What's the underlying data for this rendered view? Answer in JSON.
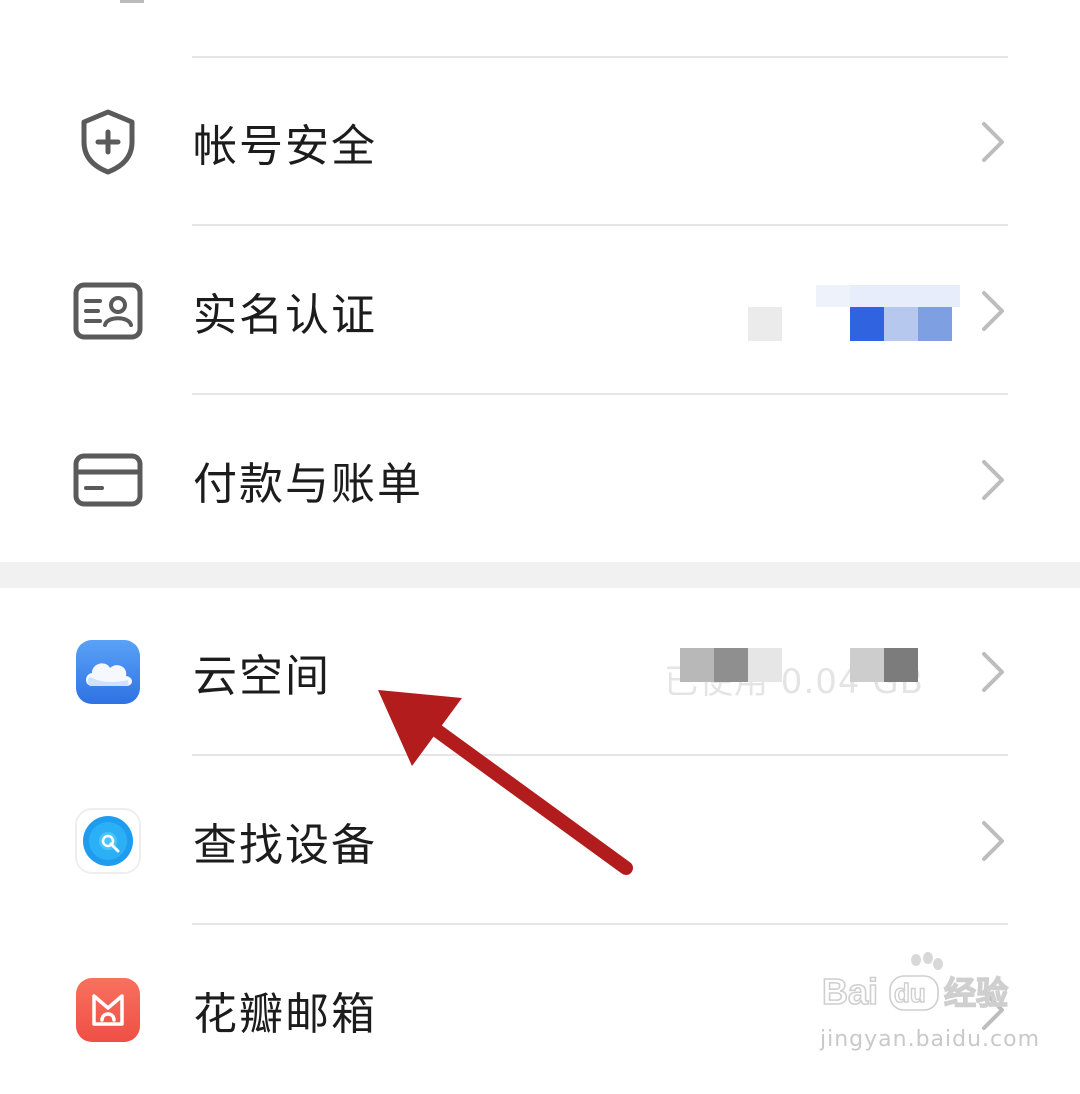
{
  "menu": {
    "items": [
      {
        "label": "帐号安全",
        "icon": "shield-plus-icon"
      },
      {
        "label": "实名认证",
        "icon": "id-card-icon"
      },
      {
        "label": "付款与账单",
        "icon": "payment-card-icon"
      },
      {
        "label": "云空间",
        "icon": "cloud-app-icon",
        "status": "已使用 0.04 GB"
      },
      {
        "label": "查找设备",
        "icon": "find-device-app-icon"
      },
      {
        "label": "花瓣邮箱",
        "icon": "petal-mail-app-icon"
      }
    ]
  },
  "watermark": {
    "logo_text": "Bai",
    "logo_suffix": "du",
    "logo_cn": "经验",
    "url": "jingyan.baidu.com"
  },
  "colors": {
    "annotation_arrow": "#b21c1c",
    "cloud_icon": "#3f86ee",
    "find_device_icon": "#1f9cf0",
    "mail_icon": "#f25e4e",
    "verified_badge": "#2f63e0"
  }
}
